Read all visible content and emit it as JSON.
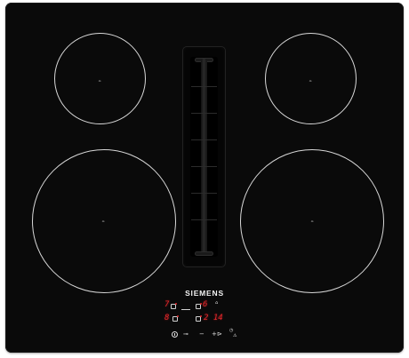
{
  "product": {
    "brand": "SIEMENS",
    "top_label": "",
    "badge": {
      "line1": "",
      "line2": "",
      "line3": ""
    }
  },
  "zones": [
    {
      "id": "rear-left",
      "mark": "∞"
    },
    {
      "id": "rear-right",
      "mark": "∞"
    },
    {
      "id": "front-left",
      "mark": "∞"
    },
    {
      "id": "front-right",
      "mark": "∞"
    }
  ],
  "panel": {
    "row1_left_digit": "7",
    "row1_right_digit": "6",
    "row2_left_digit": "8",
    "row2_right_digits": "2 14",
    "lock_symbol": "⌂",
    "bottom_controls": {
      "power_symbol": "",
      "fan_symbol": "⊸",
      "minus": "−",
      "plus_fan": "+⊳",
      "timer": "◷",
      "warn": "⚠"
    }
  },
  "colors": {
    "glass": "#0a0a0a",
    "zone_outline": "#d8d8d8",
    "display_red": "#e4262a",
    "brand_text": "#f2f2f2"
  }
}
